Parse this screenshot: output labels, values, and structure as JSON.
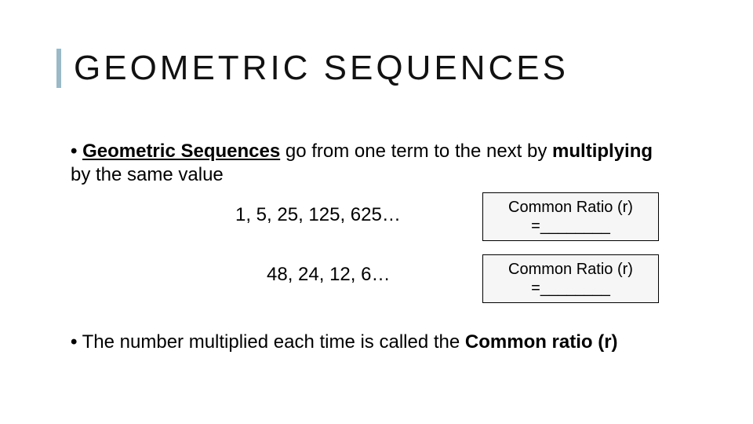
{
  "title": "GEOMETRIC SEQUENCES",
  "bullet1": {
    "term": "Geometric Sequences",
    "mid1": " go from one term to the next by ",
    "bold1": "multiplying",
    "mid2": " by the same value"
  },
  "sequences": {
    "seq1": "1, 5, 25, 125, 625…",
    "seq2": "48, 24, 12, 6…"
  },
  "boxes": {
    "line1": "Common Ratio (r)",
    "line2": "=________"
  },
  "bullet2": {
    "pre": "The number multiplied each time is called the ",
    "bold": "Common ratio (r)"
  }
}
